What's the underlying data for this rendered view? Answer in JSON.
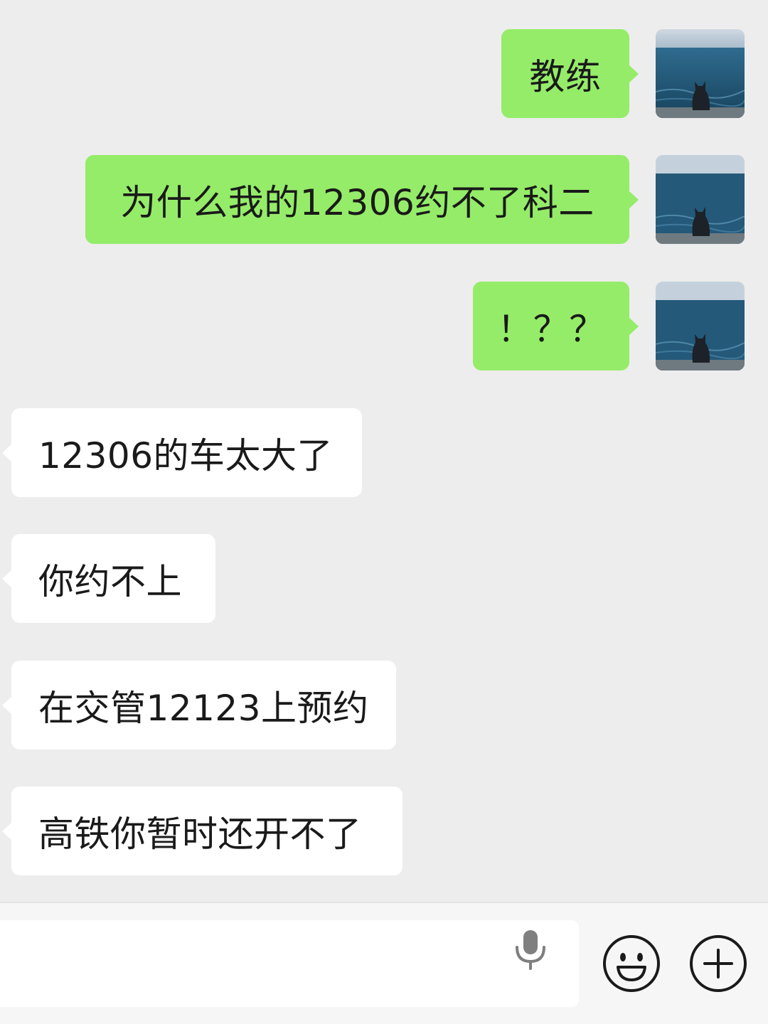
{
  "messages": [
    {
      "direction": "out",
      "text": "教练"
    },
    {
      "direction": "out",
      "text": "为什么我的12306约不了科二"
    },
    {
      "direction": "out",
      "text": "！？？"
    },
    {
      "direction": "in",
      "text": "12306的车太大了"
    },
    {
      "direction": "in",
      "text": "你约不上"
    },
    {
      "direction": "in",
      "text": "在交管12123上预约"
    },
    {
      "direction": "in",
      "text": "高铁你暂时还开不了"
    }
  ],
  "input_bar": {
    "value": "",
    "icons": [
      "microphone-icon",
      "emoji-icon",
      "plus-icon"
    ]
  },
  "colors": {
    "background": "#ededed",
    "outgoing_bubble": "#95ec69",
    "incoming_bubble": "#ffffff",
    "icon_stroke": "#1a1a1a",
    "mic_color": "#7f7f7f"
  },
  "avatar": {
    "icon": "cat-by-sea-avatar"
  }
}
